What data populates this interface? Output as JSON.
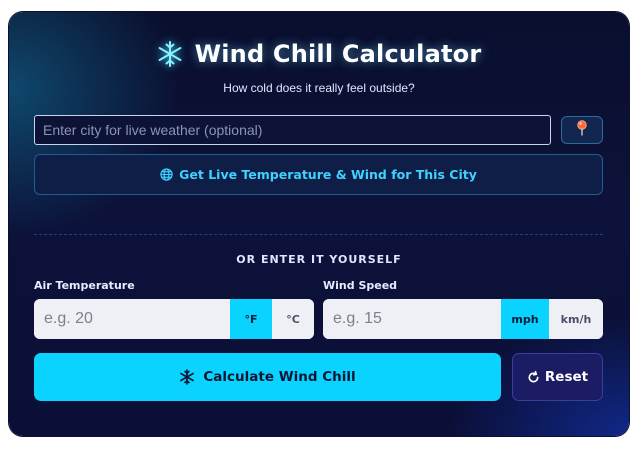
{
  "header": {
    "icon": "snowflake-icon",
    "title": "Wind Chill Calculator",
    "subtitle": "How cold does it really feel outside?"
  },
  "live": {
    "city_placeholder": "Enter city for live weather (optional)",
    "city_value": "",
    "pin_icon": "location-pin-icon",
    "fetch_icon": "globe-icon",
    "fetch_label": "Get Live Temperature & Wind for This City"
  },
  "manual": {
    "section_label": "OR ENTER IT YOURSELF",
    "temperature": {
      "label": "Air Temperature",
      "placeholder": "e.g. 20",
      "value": "",
      "units": [
        "°F",
        "°C"
      ],
      "selected_unit": "°F"
    },
    "wind": {
      "label": "Wind Speed",
      "placeholder": "e.g. 15",
      "value": "",
      "units": [
        "mph",
        "km/h"
      ],
      "selected_unit": "mph"
    }
  },
  "actions": {
    "calculate_icon": "snowflake-icon",
    "calculate_label": "Calculate Wind Chill",
    "reset_icon": "reset-icon",
    "reset_label": "Reset"
  },
  "colors": {
    "accent": "#0bd3ff",
    "link": "#3fd1ff",
    "card_background": "#0c1239",
    "reset_background": "#1b1c63"
  }
}
